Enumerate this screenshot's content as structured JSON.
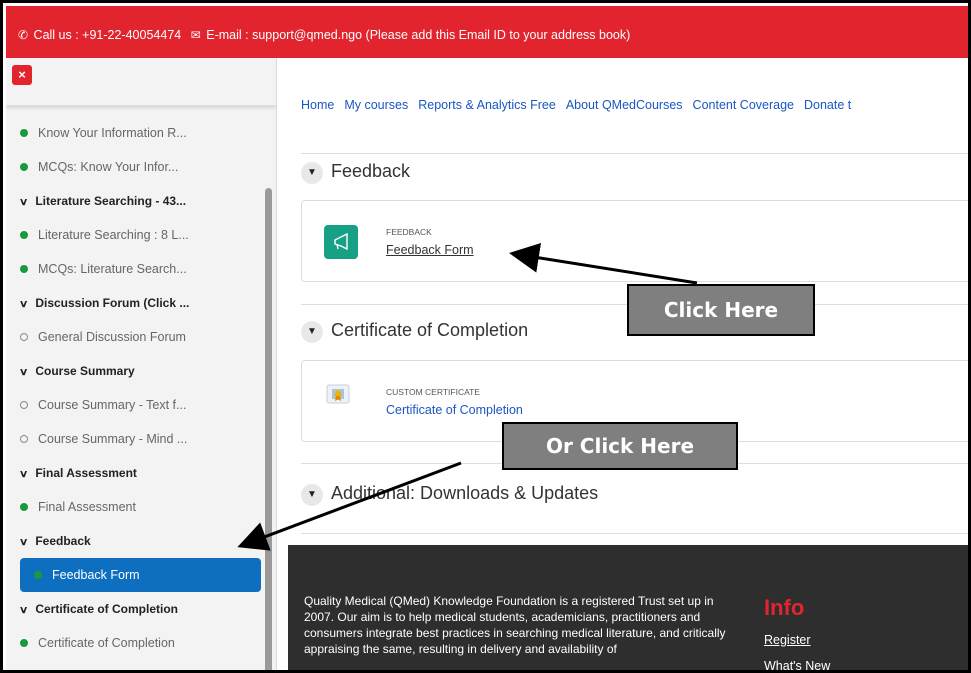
{
  "topbar": {
    "call_icon": "phone-icon",
    "text_call": "Call us : +91-22-40054474",
    "mail_icon": "envelope-icon",
    "text_email": "E-mail : support@qmed.ngo (Please add this Email ID to your address book)"
  },
  "sidebar": {
    "close_label": "×",
    "items": [
      {
        "kind": "item",
        "state": "filled",
        "label": "Know Your Information R..."
      },
      {
        "kind": "item",
        "state": "filled",
        "label": "MCQs: Know Your Infor..."
      },
      {
        "kind": "section",
        "label": "Literature Searching - 43..."
      },
      {
        "kind": "item",
        "state": "filled",
        "label": "Literature Searching : 8 L..."
      },
      {
        "kind": "item",
        "state": "filled",
        "label": "MCQs: Literature Search..."
      },
      {
        "kind": "section",
        "label": "Discussion Forum (Click ..."
      },
      {
        "kind": "item",
        "state": "empty",
        "label": "General Discussion Forum"
      },
      {
        "kind": "section",
        "label": "Course Summary"
      },
      {
        "kind": "item",
        "state": "empty",
        "label": "Course Summary - Text f..."
      },
      {
        "kind": "item",
        "state": "empty",
        "label": "Course Summary - Mind ..."
      },
      {
        "kind": "section",
        "label": "Final Assessment"
      },
      {
        "kind": "item",
        "state": "filled",
        "label": "Final Assessment"
      },
      {
        "kind": "section",
        "label": "Feedback"
      },
      {
        "kind": "item",
        "state": "active",
        "label": "Feedback Form"
      },
      {
        "kind": "section",
        "label": "Certificate of Completion"
      },
      {
        "kind": "item",
        "state": "filled",
        "label": "Certificate of Completion"
      },
      {
        "kind": "section",
        "label": "Additional: Downloads ..."
      }
    ]
  },
  "nav": [
    "Home",
    "My courses",
    "Reports & Analytics Free",
    "About QMedCourses",
    "Content Coverage",
    "Donate t"
  ],
  "sections": {
    "feedback": {
      "title": "Feedback",
      "activity_type": "FEEDBACK",
      "activity_link": "Feedback Form",
      "icon": "megaphone-icon",
      "icon_color": "#16a085"
    },
    "certificate": {
      "title": "Certificate of Completion",
      "activity_type": "CUSTOM CERTIFICATE",
      "activity_link": "Certificate of Completion",
      "icon": "certificate-icon"
    },
    "additional": {
      "title": "Additional: Downloads & Updates"
    }
  },
  "footer": {
    "about_text": "Quality Medical (QMed) Knowledge Foundation is a registered Trust set up in 2007. Our aim is to help medical students, academicians, practitioners and consumers integrate best practices in searching medical literature, and critically appraising the same, resulting in delivery and availability of",
    "info_title": "Info",
    "links": [
      "Register",
      "What's New"
    ]
  },
  "annotations": {
    "click_here": "Click Here",
    "or_click_here": "Or Click Here"
  },
  "colors": {
    "brand_red": "#e1242e",
    "link_blue": "#1a56c4",
    "active_blue": "#0e6fc1",
    "complete_green": "#1a9a3c",
    "footer_bg": "#2e2e2e"
  }
}
